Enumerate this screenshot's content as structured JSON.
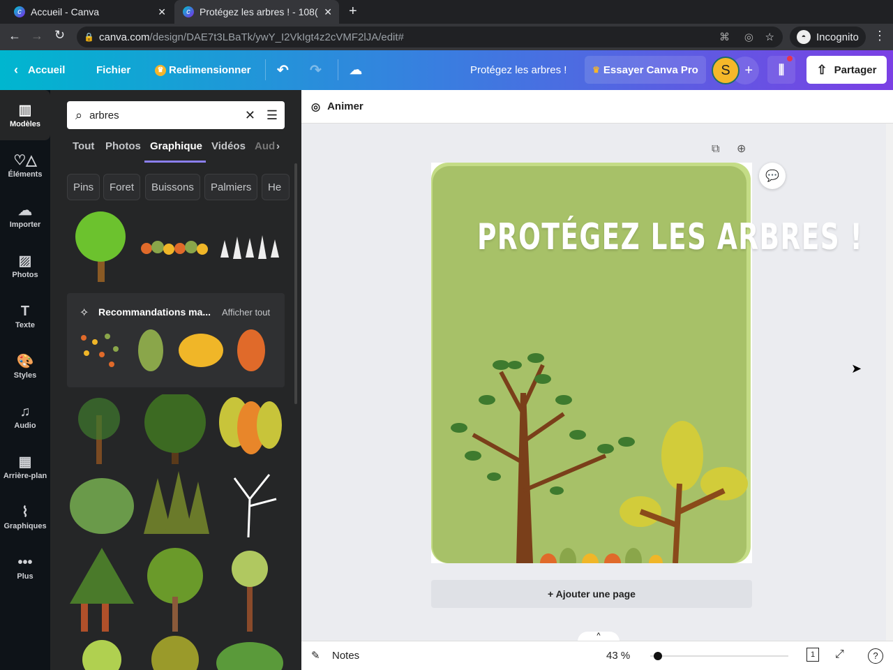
{
  "browser": {
    "tabs": [
      {
        "title": "Accueil - Canva"
      },
      {
        "title": "Protégez les arbres ! - 108("
      }
    ],
    "url_host": "canva.com",
    "url_path": "/design/DAE7t3LBaTk/ywY_I2VkIgt4z2cVMF2lJA/edit#",
    "profile": "Incognito"
  },
  "header": {
    "home": "Accueil",
    "file": "Fichier",
    "resize": "Redimensionner",
    "doc_title": "Protégez les arbres !",
    "pro": "Essayer Canva Pro",
    "avatar": "S",
    "share": "Partager"
  },
  "rail": [
    {
      "label": "Modèles",
      "icon": "▥"
    },
    {
      "label": "Éléments",
      "icon": "♡△"
    },
    {
      "label": "Importer",
      "icon": "☁"
    },
    {
      "label": "Photos",
      "icon": "▨"
    },
    {
      "label": "Texte",
      "icon": "T"
    },
    {
      "label": "Styles",
      "icon": "🎨"
    },
    {
      "label": "Audio",
      "icon": "♫"
    },
    {
      "label": "Arrière-plan",
      "icon": "▦"
    },
    {
      "label": "Graphiques",
      "icon": "⌇"
    },
    {
      "label": "Plus",
      "icon": "•••"
    }
  ],
  "panel": {
    "search_value": "arbres",
    "tabs": [
      "Tout",
      "Photos",
      "Graphique",
      "Vidéos",
      "Aud"
    ],
    "chips": [
      "Pins",
      "Foret",
      "Buissons",
      "Palmiers",
      "He"
    ],
    "reco_title": "Recommandations ma...",
    "reco_link": "Afficher tout"
  },
  "editor": {
    "animate": "Animer",
    "design_title": "PROTÉGEZ LES ARBRES !",
    "add_page": "+ Ajouter une page",
    "notes": "Notes",
    "zoom": "43 %",
    "page_count": "1",
    "colors": {
      "bg": "#a7c168",
      "trunk": "#7a3f1a",
      "leaf": "#3e7a2e"
    }
  }
}
